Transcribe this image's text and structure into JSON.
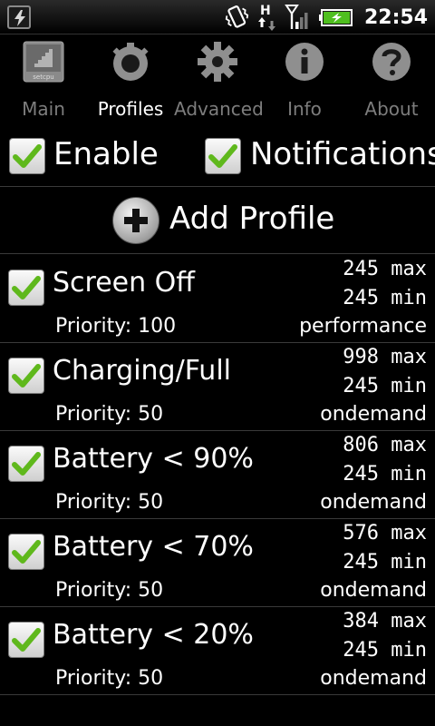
{
  "status_bar": {
    "time": "22:54",
    "network_type": "H",
    "icons": [
      "setcpu-notification-icon",
      "vibrate-icon",
      "data-arrows-icon",
      "signal-icon",
      "battery-charging-icon"
    ],
    "battery_color": "#4fbf1f"
  },
  "tabs": [
    {
      "label": "Main",
      "icon": "setcpu-chip-icon",
      "selected": false
    },
    {
      "label": "Profiles",
      "icon": "timer-icon",
      "selected": true
    },
    {
      "label": "Advanced",
      "icon": "gear-icon",
      "selected": false
    },
    {
      "label": "Info",
      "icon": "info-icon",
      "selected": false
    },
    {
      "label": "About",
      "icon": "help-icon",
      "selected": false
    }
  ],
  "chip_icon_text": "setcpu",
  "options": {
    "enable_label": "Enable",
    "enable_checked": true,
    "notifications_label": "Notifications",
    "notifications_checked": true
  },
  "add_profile": {
    "label": "Add Profile"
  },
  "profiles": [
    {
      "name": "Screen Off",
      "priority": "Priority: 100",
      "max": "245 max",
      "min": "245 min",
      "governor": "performance",
      "checked": true
    },
    {
      "name": "Charging/Full",
      "priority": "Priority: 50",
      "max": "998 max",
      "min": "245 min",
      "governor": "ondemand",
      "checked": true
    },
    {
      "name": "Battery < 90%",
      "priority": "Priority: 50",
      "max": "806 max",
      "min": "245 min",
      "governor": "ondemand",
      "checked": true
    },
    {
      "name": "Battery < 70%",
      "priority": "Priority: 50",
      "max": "576 max",
      "min": "245 min",
      "governor": "ondemand",
      "checked": true
    },
    {
      "name": "Battery < 20%",
      "priority": "Priority: 50",
      "max": "384 max",
      "min": "245 min",
      "governor": "ondemand",
      "checked": true
    }
  ],
  "colors": {
    "check_green": "#5fb81c",
    "tab_inactive": "#7d7d7d",
    "divider": "#3a3a3a"
  }
}
